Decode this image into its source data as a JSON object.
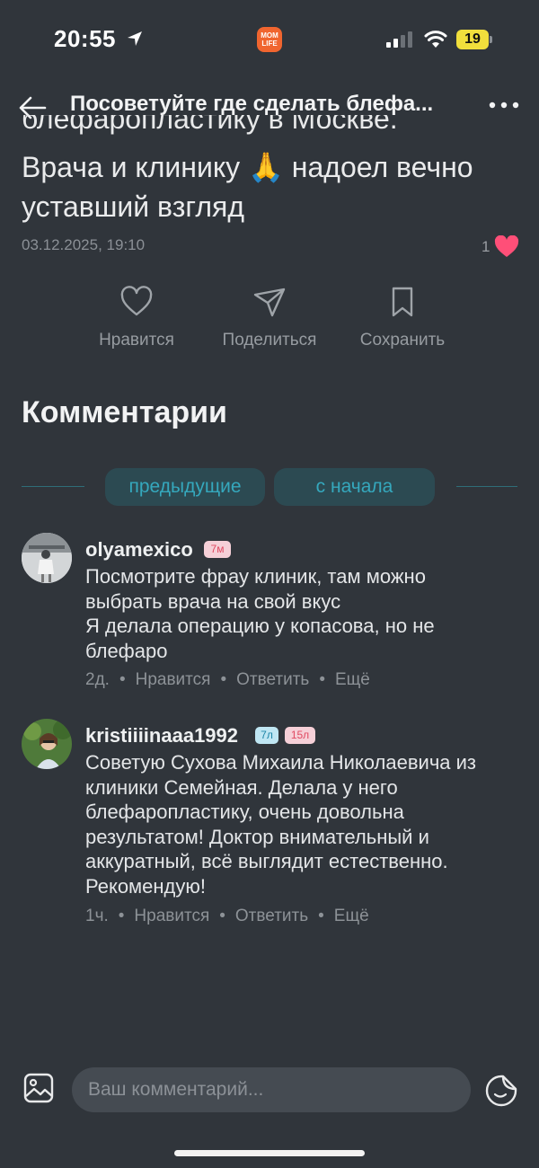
{
  "status_bar": {
    "time": "20:55",
    "app_badge": "MOM LIFE",
    "battery": "19"
  },
  "header": {
    "title": "Посоветуйте где сделать блефа..."
  },
  "post": {
    "cut_line": "блефаропластику в Москве.",
    "text": "Врача и клинику 🙏 надоел вечно уставший взгляд",
    "date": "03.12.2025, 19:10",
    "likes": "1"
  },
  "actions": {
    "like": "Нравится",
    "share": "Поделиться",
    "save": "Сохранить"
  },
  "comments_title": "Комментарии",
  "pagination": {
    "previous": "предыдущие",
    "from_start": "с начала"
  },
  "comments": [
    {
      "user": "olyamexico",
      "tags": [
        "7м"
      ],
      "lines": [
        "Посмотрите фрау клиник, там можно",
        "выбрать врача на свой вкус",
        "Я делала операцию у копасова, но не",
        "блефаро"
      ],
      "time": "2д.",
      "like": "Нравится",
      "reply": "Ответить",
      "more": "Ещё"
    },
    {
      "user": "kristiiiinaaa1992",
      "tags": [
        "7л",
        "15л"
      ],
      "lines": [
        "Советую Сухова Михаила Николаевича из",
        "клиники Семейная. Делала у него",
        "блефаропластику, очень довольна",
        "результатом! Доктор внимательный и",
        "аккуратный, всё выглядит естественно.",
        "Рекомендую!"
      ],
      "time": "1ч.",
      "like": "Нравится",
      "reply": "Ответить",
      "more": "Ещё"
    }
  ],
  "meta_separator": "•",
  "comment_input": {
    "placeholder": "Ваш комментарий..."
  },
  "colors": {
    "background": "#30353b",
    "accent": "#35a8bd",
    "heart": "#ff4f78"
  },
  "icons": [
    "location-arrow-icon",
    "signal-icon",
    "wifi-icon",
    "back-arrow-icon",
    "more-dots-icon",
    "heart-icon",
    "share-icon",
    "bookmark-icon",
    "gallery-icon",
    "sticker-icon"
  ]
}
